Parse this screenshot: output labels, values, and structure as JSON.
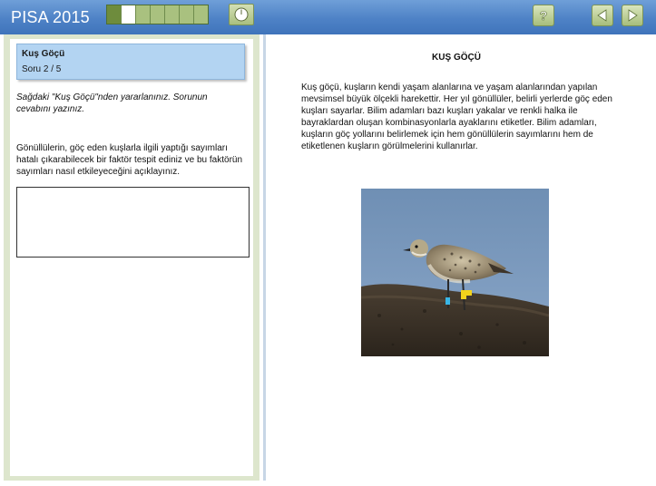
{
  "header": {
    "app_title": "PISA 2015",
    "progress": {
      "total_segments": 8,
      "done_segments": 1,
      "current_segment": 2
    },
    "icons": {
      "timer": "timer-icon",
      "help": "help-icon",
      "previous": "arrow-left-icon",
      "next": "arrow-right-icon"
    },
    "help_label": "?"
  },
  "left_panel": {
    "unit_title": "Kuş Göçü",
    "unit_subtitle": "Soru 2 / 5",
    "instruction": "Sağdaki \"Kuş Göçü\"nden yararlanınız. Sorunun cevabını yazınız.",
    "question": "Gönüllülerin, göç eden kuşlarla ilgili yaptığı sayımları hatalı çıkarabilecek bir faktör tespit ediniz ve bu faktörün sayımları nasıl etkileyeceğini açıklayınız.",
    "answer_value": ""
  },
  "right_panel": {
    "title": "KUŞ GÖÇÜ",
    "body": "Kuş göçü, kuşların kendi yaşam alanlarına ve yaşam alanlarından yapılan mevsimsel büyük ölçekli harekettir. Her yıl gönüllüler, belirli yerlerde göç eden kuşları sayarlar. Bilim adamları bazı kuşları yakalar ve renkli halka ile bayraklardan oluşan kombinasyonlarla ayaklarını etiketler. Bilim adamları, kuşların göç yollarını belirlemek için hem gönüllülerin sayımlarını hem de etiketlenen kuşların görülmelerini kullanırlar."
  },
  "colors": {
    "header_blue": "#4e82c6",
    "progress_done": "#6e8c3d",
    "progress_todo": "#a9c17f",
    "unit_box": "#b3d4f2",
    "left_frame": "#dde6cd"
  }
}
